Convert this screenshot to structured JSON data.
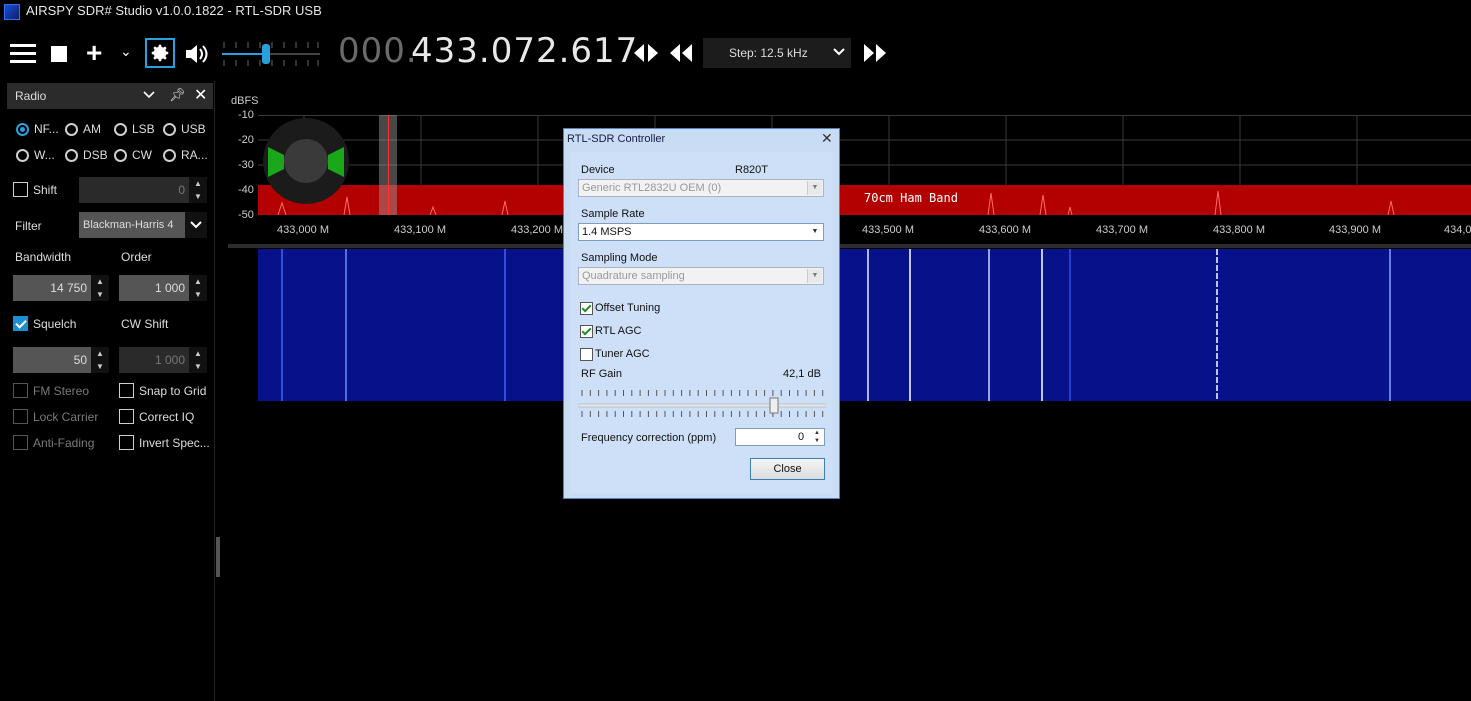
{
  "window": {
    "title": "AIRSPY SDR# Studio v1.0.0.1822 - RTL-SDR USB"
  },
  "toolbar": {
    "frequency_prefix": "000.",
    "frequency_main": "433.072.617",
    "step_label": "Step: 12.5 kHz",
    "volume_level": 0.45
  },
  "radio_panel": {
    "title": "Radio",
    "modes": [
      {
        "label": "NF...",
        "selected": true
      },
      {
        "label": "AM",
        "selected": false
      },
      {
        "label": "LSB",
        "selected": false
      },
      {
        "label": "USB",
        "selected": false
      },
      {
        "label": "W...",
        "selected": false
      },
      {
        "label": "DSB",
        "selected": false
      },
      {
        "label": "CW",
        "selected": false
      },
      {
        "label": "RA...",
        "selected": false
      }
    ],
    "shift_label": "Shift",
    "shift_value": "0",
    "filter_label": "Filter",
    "filter_value": "Blackman-Harris 4",
    "bandwidth_label": "Bandwidth",
    "bandwidth_value": "14 750",
    "order_label": "Order",
    "order_value": "1 000",
    "squelch_label": "Squelch",
    "squelch_value": "50",
    "cw_shift_label": "CW Shift",
    "cw_shift_value": "1 000",
    "fm_stereo_label": "FM Stereo",
    "snap_label": "Snap to Grid",
    "lock_carrier_label": "Lock Carrier",
    "correct_iq_label": "Correct IQ",
    "anti_fading_label": "Anti-Fading",
    "invert_spec_label": "Invert Spec..."
  },
  "spectrum": {
    "unit_label": "dBFS",
    "y_ticks": [
      "-10",
      "-20",
      "-30",
      "-40",
      "-50"
    ],
    "x_ticks": [
      "433,000 M",
      "433,100 M",
      "433,200 M",
      "433,500 M",
      "433,600 M",
      "433,700 M",
      "433,800 M",
      "433,900 M",
      "434,0"
    ],
    "band_label": "70cm Ham Band",
    "colors": {
      "band": "#b30000",
      "waterfall": "#06118a",
      "grid": "#3a3a3a"
    }
  },
  "dialog": {
    "title": "RTL-SDR Controller",
    "device_label": "Device",
    "tuner_label": "R820T",
    "device_value": "Generic RTL2832U OEM (0)",
    "sample_rate_label": "Sample Rate",
    "sample_rate_value": "1.4 MSPS",
    "sampling_mode_label": "Sampling Mode",
    "sampling_mode_value": "Quadrature sampling",
    "offset_tuning_label": "Offset Tuning",
    "rtl_agc_label": "RTL AGC",
    "tuner_agc_label": "Tuner AGC",
    "rf_gain_label": "RF Gain",
    "rf_gain_value": "42,1 dB",
    "rf_gain_level": 0.8,
    "ppm_label": "Frequency correction (ppm)",
    "ppm_value": "0",
    "close_label": "Close"
  }
}
